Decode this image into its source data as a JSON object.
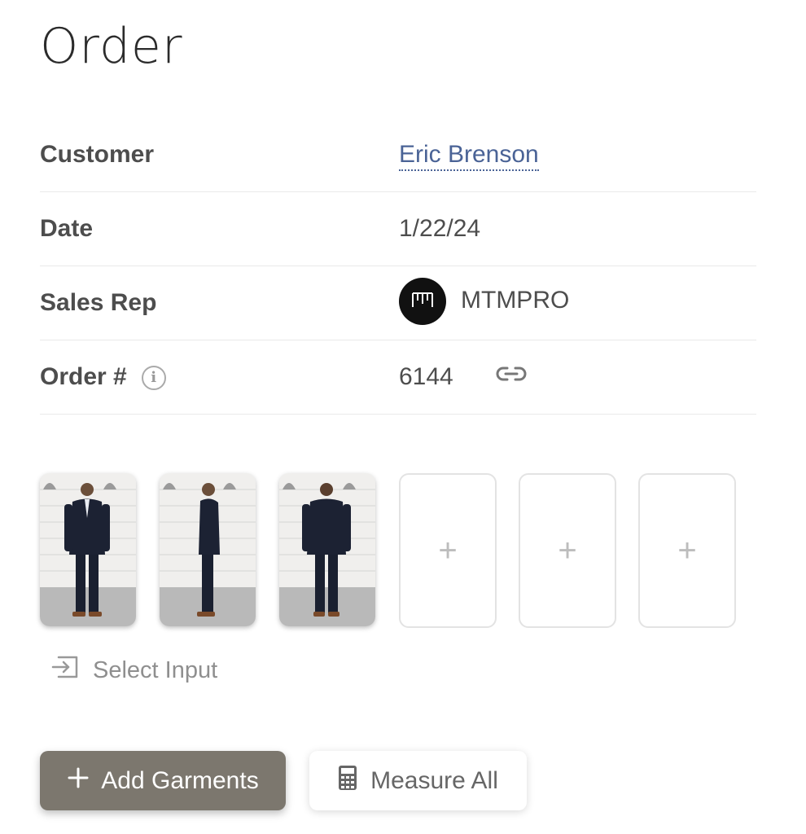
{
  "page": {
    "title": "Order"
  },
  "details": {
    "customer": {
      "label": "Customer",
      "value": "Eric Brenson"
    },
    "date": {
      "label": "Date",
      "value": "1/22/24"
    },
    "sales_rep": {
      "label": "Sales Rep",
      "value": "MTMPRO"
    },
    "order_number": {
      "label": "Order #",
      "value": "6144"
    }
  },
  "images": {
    "photos": [
      "front",
      "side",
      "back"
    ],
    "empty_slot_symbol": "+"
  },
  "select_input": {
    "label": "Select Input"
  },
  "actions": {
    "add_garments": {
      "label": "Add Garments",
      "icon": "plus-icon"
    },
    "measure_all": {
      "label": "Measure All",
      "icon": "calculator-icon"
    }
  },
  "colors": {
    "link": "#4a6396",
    "primary_button": "#7c776e"
  }
}
